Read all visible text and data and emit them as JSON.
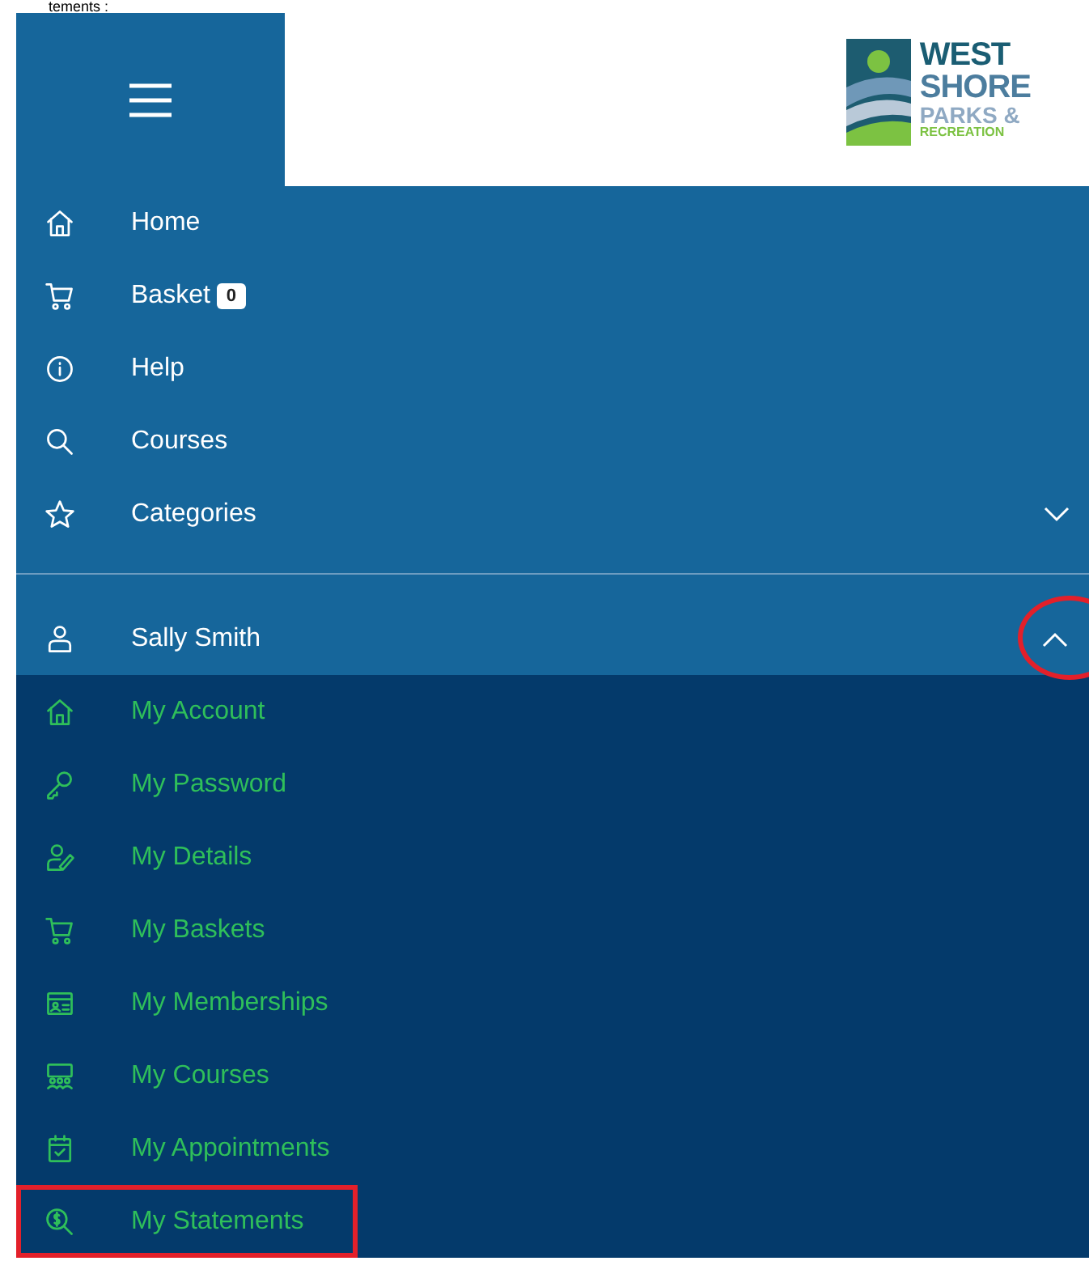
{
  "caption": "tements :",
  "header": {
    "logo_lines": [
      "WEST",
      "SHORE",
      "PARKS &",
      "RECREATION"
    ]
  },
  "menu": [
    {
      "label": "Home"
    },
    {
      "label": "Basket",
      "badge": "0"
    },
    {
      "label": "Help"
    },
    {
      "label": "Courses"
    },
    {
      "label": "Categories",
      "expanded": false
    }
  ],
  "user": {
    "label": "Sally Smith",
    "expanded": true,
    "circled": true
  },
  "account_menu": [
    {
      "label": "My Account",
      "boxed": false
    },
    {
      "label": "My Password",
      "boxed": false
    },
    {
      "label": "My Details",
      "boxed": false
    },
    {
      "label": "My Baskets",
      "boxed": false
    },
    {
      "label": "My Memberships",
      "boxed": false
    },
    {
      "label": "My Courses",
      "boxed": false
    },
    {
      "label": "My Appointments",
      "boxed": false
    },
    {
      "label": "My Statements",
      "boxed": true
    }
  ]
}
